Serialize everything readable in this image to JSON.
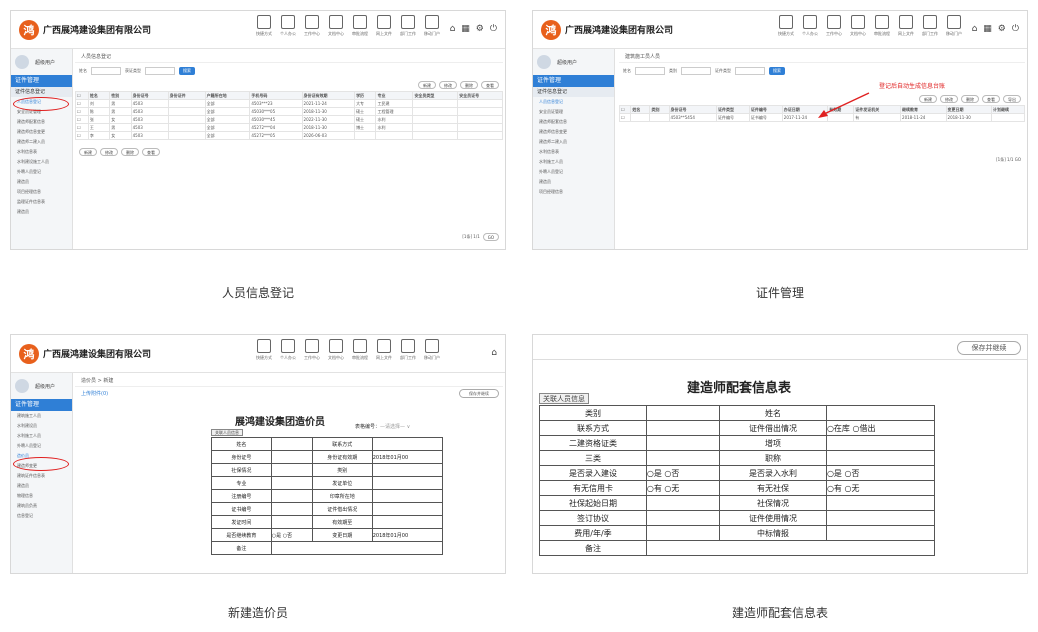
{
  "company": "广西展鸿建设集团有限公司",
  "captions": [
    "人员信息登记",
    "证件管理",
    "新建造价员",
    "建造师配套信息表"
  ],
  "toolbar": [
    "快捷方式",
    "个人办公",
    "工作中心",
    "文档中心",
    "审批流程",
    "网上文件",
    "部门工作",
    "移动门户"
  ],
  "user": "超级用户",
  "sidebar": {
    "section": "证件管理",
    "sub": "证件信息登记",
    "items1": [
      "人员信息登记",
      "安全员证管理",
      "建造师配套信息",
      "建造师信息变更",
      "建造师二建入员",
      "水利信息表",
      "水利建设施工人员",
      "外聘人员登记",
      "建造员",
      "项目经理信息",
      "监理证件信息表",
      "建造员"
    ],
    "items2": [
      "人员信息登记",
      "安全员证管理",
      "建造师配套信息",
      "建造师信息变更",
      "建造师二建入员",
      "水利信息表",
      "水利施工人员",
      "外聘人员登记",
      "建造员",
      "项目经理信息"
    ],
    "items3": [
      "建筑施工人员",
      "水利建设员",
      "水利施工人员",
      "外聘人员登记",
      "造价员",
      "建造师变更",
      "建筑证件信息表",
      "建造员",
      "物理信息",
      "建筑员负责",
      "信息登记"
    ]
  },
  "p1": {
    "breadcrumb": "人员信息登记",
    "filter": {
      "name_label": "姓名",
      "type_label": "获证类型",
      "search": "搜索"
    },
    "buttons": [
      "新建",
      "修改",
      "删除",
      "查看"
    ],
    "headers": [
      "姓名",
      "性别",
      "身份证号",
      "身份证件",
      "户籍所在地",
      "手机号码",
      "身份证有效期",
      "学历",
      "专业",
      "安全员类型",
      "安全员证号"
    ],
    "rows": [
      [
        "刘",
        "男",
        "4503",
        "",
        "全部",
        "4503***23",
        "2021-11-24",
        "大专",
        "工民建"
      ],
      [
        "陈",
        "男",
        "4503",
        "",
        "全部",
        "45030***05",
        "2018-11-30",
        "硕士",
        "工程管理"
      ],
      [
        "张",
        "女",
        "4503",
        "",
        "全部",
        "45030***45",
        "2022-11-30",
        "硕士",
        "水利"
      ],
      [
        "王",
        "男",
        "4503",
        "",
        "全部",
        "45272***04",
        "2018-11-30",
        "博士",
        "水利"
      ],
      [
        "李",
        "女",
        "4503",
        "",
        "全部",
        "45272***05",
        "2026-06-03",
        "",
        ""
      ]
    ],
    "footer_buttons": [
      "新建",
      "修改",
      "删除",
      "查看"
    ],
    "pager": "[1条] 1/1"
  },
  "p2": {
    "breadcrumb": "建筑施工员人员",
    "filter": {
      "a": "姓名",
      "b": "类别",
      "c": "证件类型",
      "search": "搜索"
    },
    "annotation": "登记后自动生成信息台账",
    "buttons": [
      "新建",
      "修改",
      "删除",
      "查看",
      "导出"
    ],
    "headers": [
      "姓名",
      "类别",
      "身份证号",
      "证件类型",
      "证件编号",
      "办证日期",
      "有效期",
      "证件发证机关",
      "继续教育",
      "变更日期",
      "计划继续"
    ],
    "row": [
      "",
      "",
      "4503**5454",
      "证件编号",
      "证书编号",
      "2017-11-24",
      "",
      "有",
      "2018-11-24",
      "2018-11-30",
      ""
    ],
    "pager": "[1条] 1/1 GO"
  },
  "p3": {
    "breadcrumb": "造价员 > 新建",
    "save": "保存并继续",
    "upload": "上传附件(0)",
    "title": "展鸿建设集团造价员",
    "tab": "关联人员信息",
    "form_no": "表格编号：",
    "rows": [
      [
        "姓名",
        "",
        "联系方式",
        ""
      ],
      [
        "身份证号",
        "",
        "身份证有效期",
        "2018年01月00"
      ],
      [
        "社保情况",
        "",
        "类别",
        ""
      ],
      [
        "专业",
        "",
        "发证单位",
        ""
      ],
      [
        "注册编号",
        "",
        "印章所在地",
        ""
      ],
      [
        "证书编号",
        "",
        "证件借出情况",
        ""
      ],
      [
        "发证时间",
        "",
        "有效期至",
        ""
      ],
      [
        "是否继续教育",
        "○是 ○否",
        "变更日期",
        "2018年01月00"
      ],
      [
        "备注",
        "",
        "",
        ""
      ]
    ]
  },
  "p4": {
    "save": "保存并继续",
    "title": "建造师配套信息表",
    "tab": "关联人员信息",
    "rows": [
      [
        "类别",
        "",
        "姓名",
        ""
      ],
      [
        "联系方式",
        "",
        "证件借出情况",
        "○在库 ○借出"
      ],
      [
        "二建资格证类",
        "",
        "增项",
        ""
      ],
      [
        "三类",
        "",
        "职称",
        ""
      ],
      [
        "是否录入建设",
        "○是 ○否",
        "是否录入水利",
        "○是 ○否"
      ],
      [
        "有无信用卡",
        "○有 ○无",
        "有无社保",
        "○有 ○无"
      ],
      [
        "社保起始日期",
        "",
        "社保情况",
        ""
      ],
      [
        "签订协议",
        "",
        "证件使用情况",
        ""
      ],
      [
        "费用/年/季",
        "",
        "中标情报",
        ""
      ],
      [
        "备注",
        "",
        "",
        ""
      ]
    ]
  }
}
